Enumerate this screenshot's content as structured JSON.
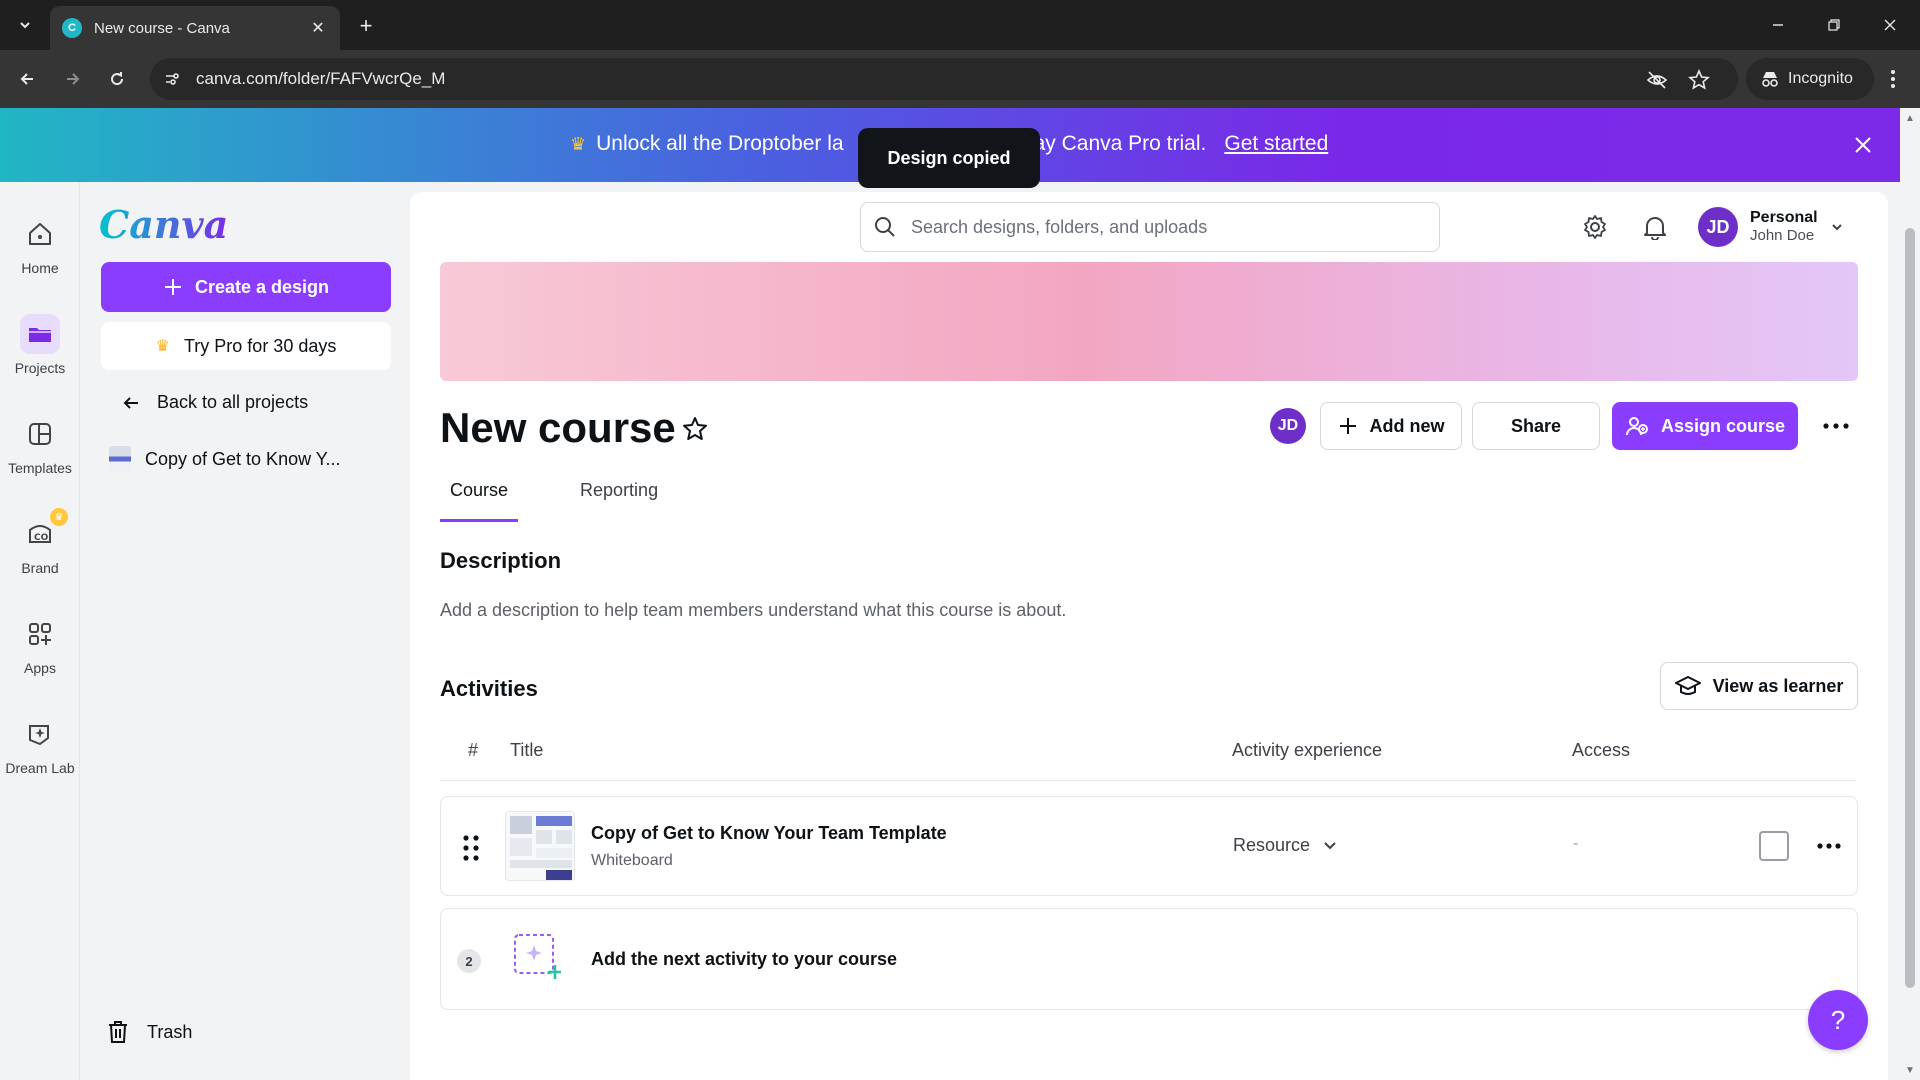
{
  "browser": {
    "tab_title": "New course - Canva",
    "favicon_letter": "C",
    "url": "canva.com/folder/FAFVwcrQe_M",
    "incognito_label": "Incognito"
  },
  "promo": {
    "text": "Unlock all the Droptober la",
    "text_tail": "ay Canva Pro trial.",
    "link": "Get started"
  },
  "toast": "Design copied",
  "rail": [
    {
      "label": "Home",
      "icon": "home-icon"
    },
    {
      "label": "Projects",
      "icon": "folder-icon"
    },
    {
      "label": "Templates",
      "icon": "templates-icon"
    },
    {
      "label": "Brand",
      "icon": "brand-icon"
    },
    {
      "label": "Apps",
      "icon": "apps-icon"
    },
    {
      "label": "Dream Lab",
      "icon": "dream-lab-icon"
    }
  ],
  "sidebar": {
    "logo": "Canva",
    "create_label": "Create a design",
    "trypro_label": "Try Pro for 30 days",
    "back_label": "Back to all projects",
    "project_item": "Copy of Get to Know Y...",
    "trash_label": "Trash"
  },
  "header": {
    "search_placeholder": "Search designs, folders, and uploads",
    "avatar_initials": "JD",
    "account_type": "Personal",
    "account_name": "John Doe"
  },
  "course": {
    "title": "New course",
    "collab_initials": "JD",
    "add_new_label": "Add new",
    "share_label": "Share",
    "assign_label": "Assign course",
    "tabs": [
      {
        "label": "Course",
        "active": true
      },
      {
        "label": "Reporting",
        "active": false
      }
    ],
    "description_heading": "Description",
    "description_text": "Add a description to help team members understand what this course is about.",
    "activities_heading": "Activities",
    "view_as_learner_label": "View as learner",
    "columns": {
      "num": "#",
      "title": "Title",
      "experience": "Activity experience",
      "access": "Access"
    },
    "activities": [
      {
        "title": "Copy of Get to Know Your Team Template",
        "type": "Whiteboard",
        "experience": "Resource",
        "access": "-"
      }
    ],
    "next_number": "2",
    "add_next_label": "Add the next activity to your course"
  },
  "help_label": "?",
  "colors": {
    "primary": "#8b3dff",
    "avatar": "#6e2fc8"
  }
}
